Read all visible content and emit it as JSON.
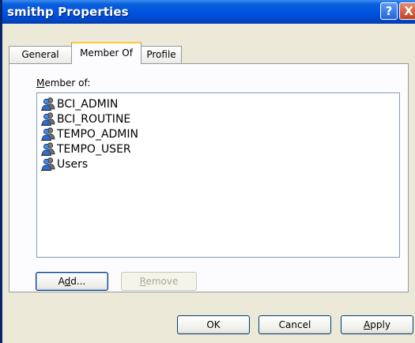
{
  "window": {
    "title": "smithp Properties",
    "help_glyph": "?",
    "close_glyph": "X"
  },
  "tabs": [
    {
      "label": "General",
      "active": false
    },
    {
      "label": "Member Of",
      "active": true
    },
    {
      "label": "Profile",
      "active": false
    }
  ],
  "member_of": {
    "label_mnemonic": "M",
    "label_rest": "ember of:",
    "items": [
      {
        "name": "BCI_ADMIN",
        "icon": "group-icon"
      },
      {
        "name": "BCI_ROUTINE",
        "icon": "group-icon"
      },
      {
        "name": "TEMPO_ADMIN",
        "icon": "group-icon"
      },
      {
        "name": "TEMPO_USER",
        "icon": "group-icon"
      },
      {
        "name": "Users",
        "icon": "group-icon"
      }
    ],
    "add_label_pre": "A",
    "add_label_mnemonic": "d",
    "add_label_post": "d...",
    "remove_label_mnemonic": "R",
    "remove_label_rest": "emove"
  },
  "footer": {
    "ok_label": "OK",
    "cancel_label": "Cancel",
    "apply_label_mnemonic": "A",
    "apply_label_rest": "pply"
  },
  "colors": {
    "titlebar": "#0054e3",
    "window_bg": "#ece9d8",
    "active_tab_accent": "#ffc83c"
  }
}
